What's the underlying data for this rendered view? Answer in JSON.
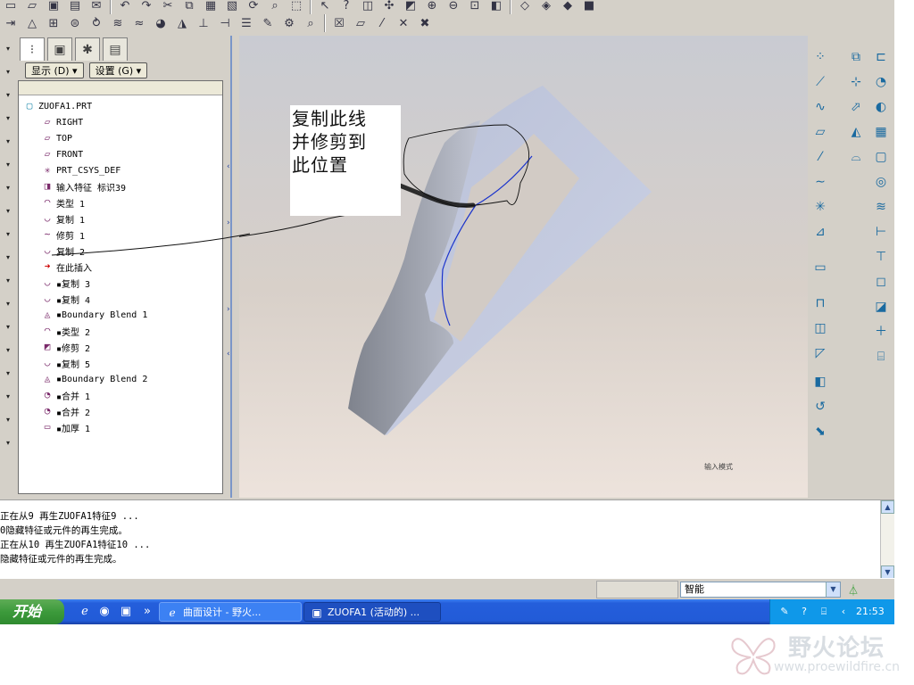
{
  "model_tree": {
    "tab_icons": [
      "model-tree-icon",
      "layers-icon",
      "star-icon",
      "folder-settings-icon"
    ],
    "display_button": "显示 (D) ▾",
    "settings_button": "设置 (G) ▾",
    "items": [
      {
        "label": "ZUOFA1.PRT",
        "icon": "part-icon",
        "level": "root"
      },
      {
        "label": "RIGHT",
        "icon": "datum-plane-icon",
        "level": "child"
      },
      {
        "label": "TOP",
        "icon": "datum-plane-icon",
        "level": "child"
      },
      {
        "label": "FRONT",
        "icon": "datum-plane-icon",
        "level": "child"
      },
      {
        "label": "PRT_CSYS_DEF",
        "icon": "csys-icon",
        "level": "child"
      },
      {
        "label": "输入特征 标识39",
        "icon": "import-feature-icon",
        "level": "child"
      },
      {
        "label": "类型 1",
        "icon": "surface-icon",
        "level": "child"
      },
      {
        "label": "复制 1",
        "icon": "copy-surface-icon",
        "level": "child"
      },
      {
        "label": "修剪 1",
        "icon": "trim-curve-icon",
        "level": "child"
      },
      {
        "label": "复制 2",
        "icon": "copy-surface-icon",
        "level": "child"
      },
      {
        "label": "在此插入",
        "icon": "insert-here-icon",
        "level": "child"
      },
      {
        "label": "▪复制 3",
        "icon": "copy-surface-icon",
        "level": "child"
      },
      {
        "label": "▪复制 4",
        "icon": "copy-surface-icon",
        "level": "child"
      },
      {
        "label": "▪Boundary Blend 1",
        "icon": "boundary-blend-icon",
        "level": "child"
      },
      {
        "label": "▪类型 2",
        "icon": "surface-icon",
        "level": "child"
      },
      {
        "label": "▪修剪 2",
        "icon": "trim-surface-icon",
        "level": "child"
      },
      {
        "label": "▪复制 5",
        "icon": "copy-surface-icon",
        "level": "child"
      },
      {
        "label": "▪Boundary Blend 2",
        "icon": "boundary-blend-icon",
        "level": "child"
      },
      {
        "label": "▪合并 1",
        "icon": "merge-icon",
        "level": "child"
      },
      {
        "label": "▪合并 2",
        "icon": "merge-icon",
        "level": "child"
      },
      {
        "label": "▪加厚 1",
        "icon": "thicken-icon",
        "level": "child"
      }
    ]
  },
  "viewport": {
    "annotation_note": [
      "复制此线",
      "并修剪到",
      "此位置"
    ],
    "corner_label": "输入模式"
  },
  "messages": [
    "正在从9 再生ZUOFA1特征9 ...",
    "0隐藏特征或元件的再生完成。",
    "正在从10 再生ZUOFA1特征10 ...",
    "隐藏特征或元件的再生完成。"
  ],
  "status": {
    "filter_value": "智能"
  },
  "taskbar": {
    "start_label": "开始",
    "tasks": [
      {
        "label": "曲面设计 - 野火...",
        "icon": "browser-icon",
        "active": false
      },
      {
        "label": "ZUOFA1 (活动的) ...",
        "icon": "proe-window-icon",
        "active": true
      }
    ],
    "clock": "21:53"
  },
  "watermark": {
    "title": "野火论坛",
    "url": "www.proewildfire.cn"
  },
  "colors": {
    "surface_light": "#c3c9de",
    "surface_dark": "#8e929c",
    "edge_blue": "#1a33cc",
    "insert_arrow": "#cc0000",
    "taskbar_blue": "#245edb",
    "start_green": "#3c9a3b"
  }
}
